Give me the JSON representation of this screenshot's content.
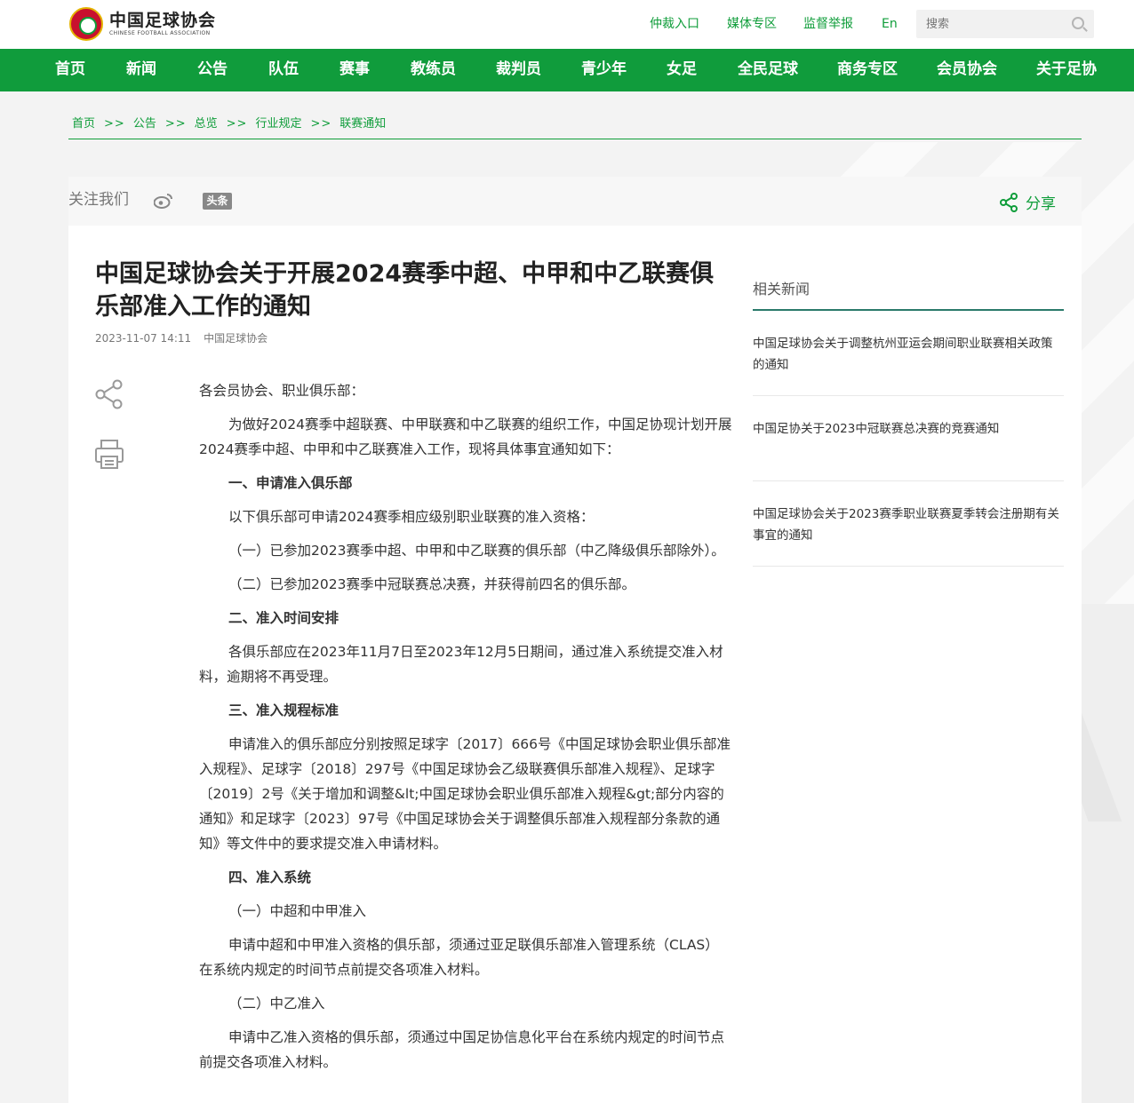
{
  "header": {
    "logo_cn": "中国足球协会",
    "logo_en": "CHINESE FOOTBALL ASSOCIATION",
    "links": [
      "仲裁入口",
      "媒体专区",
      "监督举报",
      "En"
    ],
    "search_placeholder": "搜索"
  },
  "nav": [
    "首页",
    "新闻",
    "公告",
    "队伍",
    "赛事",
    "教练员",
    "裁判员",
    "青少年",
    "女足",
    "全民足球",
    "商务专区",
    "会员协会",
    "关于足协"
  ],
  "breadcrumb": [
    "首页",
    "公告",
    "总览",
    "行业规定",
    "联赛通知"
  ],
  "breadcrumb_sep": ">>",
  "follow": {
    "label": "关注我们",
    "toutiao": "头条",
    "share": "分享"
  },
  "article": {
    "title": "中国足球协会关于开展2024赛季中超、中甲和中乙联赛俱乐部准入工作的通知",
    "date": "2023-11-07 14:11",
    "source": "中国足球协会",
    "paragraphs": [
      "各会员协会、职业俱乐部：",
      "为做好2024赛季中超联赛、中甲联赛和中乙联赛的组织工作，中国足协现计划开展2024赛季中超、中甲和中乙联赛准入工作，现将具体事宜通知如下：",
      "一、申请准入俱乐部",
      "以下俱乐部可申请2024赛季相应级别职业联赛的准入资格：",
      "（一）已参加2023赛季中超、中甲和中乙联赛的俱乐部（中乙降级俱乐部除外）。",
      "（二）已参加2023赛季中冠联赛总决赛，并获得前四名的俱乐部。",
      "二、准入时间安排",
      "各俱乐部应在2023年11月7日至2023年12月5日期间，通过准入系统提交准入材料，逾期将不再受理。",
      "三、准入规程标准",
      "申请准入的俱乐部应分别按照足球字〔2017〕666号《中国足球协会职业俱乐部准入规程》、足球字〔2018〕297号《中国足球协会乙级联赛俱乐部准入规程》、足球字〔2019〕2号《关于增加和调整&lt;中国足球协会职业俱乐部准入规程&gt;部分内容的通知》和足球字〔2023〕97号《中国足球协会关于调整俱乐部准入规程部分条款的通知》等文件中的要求提交准入申请材料。",
      "四、准入系统",
      "（一）中超和中甲准入",
      "申请中超和中甲准入资格的俱乐部，须通过亚足联俱乐部准入管理系统（CLAS）在系统内规定的时间节点前提交各项准入材料。",
      "（二）中乙准入",
      "申请中乙准入资格的俱乐部，须通过中国足协信息化平台在系统内规定的时间节点前提交各项准入材料。"
    ]
  },
  "related": {
    "title": "相关新闻",
    "items": [
      "中国足球协会关于调整杭州亚运会期间职业联赛相关政策的通知",
      "中国足协关于2023中冠联赛总决赛的竞赛通知",
      "中国足球协会关于2023赛季职业联赛夏季转会注册期有关事宜的通知"
    ]
  },
  "colors": {
    "brand_green": "#109c3c",
    "divider_teal": "#2a7a6a"
  }
}
